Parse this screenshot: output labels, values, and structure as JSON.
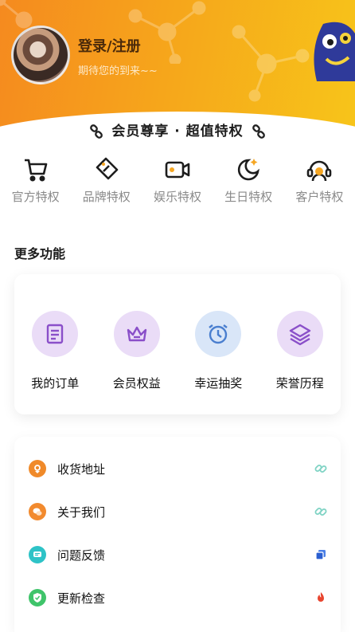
{
  "header": {
    "login_title": "登录/注册",
    "login_subtitle": "期待您的到来~~",
    "gradient_colors": [
      "#f58a1f",
      "#f7c51a"
    ]
  },
  "vip": {
    "title": "会员尊享 · 超值特权",
    "privileges": [
      {
        "label": "官方特权",
        "icon": "shopping-cart-icon"
      },
      {
        "label": "品牌特权",
        "icon": "tag-icon"
      },
      {
        "label": "娱乐特权",
        "icon": "video-camera-icon"
      },
      {
        "label": "生日特权",
        "icon": "moon-star-icon"
      },
      {
        "label": "客户特权",
        "icon": "customer-service-icon"
      }
    ]
  },
  "more": {
    "title": "更多功能",
    "items": [
      {
        "label": "我的订单",
        "icon": "order-list-icon",
        "color": "#a76fd8"
      },
      {
        "label": "会员权益",
        "icon": "crown-icon",
        "color": "#a76fd8"
      },
      {
        "label": "幸运抽奖",
        "icon": "alarm-clock-icon",
        "color": "#5b8fd9"
      },
      {
        "label": "荣誉历程",
        "icon": "layers-icon",
        "color": "#a76fd8"
      }
    ]
  },
  "settings": {
    "items": [
      {
        "label": "收货地址",
        "icon": "address-icon",
        "color": "#f08a2a",
        "trail": "link-icon"
      },
      {
        "label": "关于我们",
        "icon": "wechat-icon",
        "color": "#f28a2e",
        "trail": "link-icon"
      },
      {
        "label": "问题反馈",
        "icon": "chat-icon",
        "color": "#2ec3c7",
        "trail": "copy-icon"
      },
      {
        "label": "更新检查",
        "icon": "shield-check-icon",
        "color": "#3fc46a",
        "trail": "fire-icon"
      }
    ]
  }
}
